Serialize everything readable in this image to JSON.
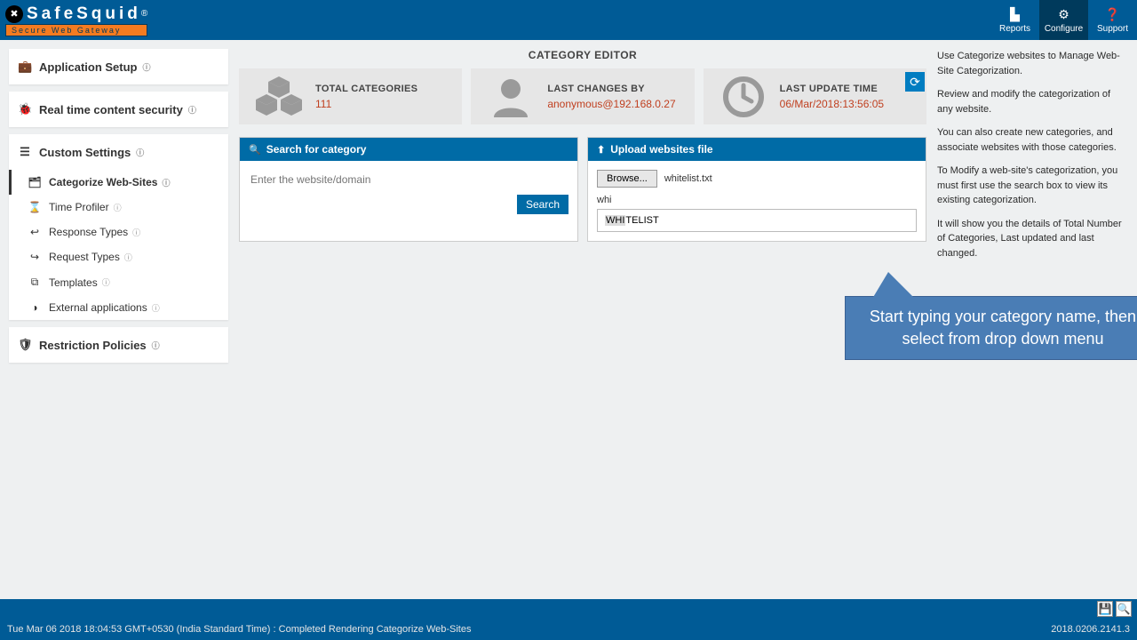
{
  "brand": {
    "name": "SafeSquid",
    "reg": "®",
    "tagline": "Secure Web Gateway"
  },
  "nav": {
    "reports": "Reports",
    "configure": "Configure",
    "support": "Support"
  },
  "sidebar": {
    "groups": [
      {
        "label": "Application Setup"
      },
      {
        "label": "Real time content security"
      },
      {
        "label": "Custom Settings",
        "items": [
          {
            "icon": "🗂",
            "label": "Categorize Web-Sites",
            "active": true
          },
          {
            "icon": "⌛",
            "label": "Time Profiler"
          },
          {
            "icon": "↩",
            "label": "Response Types"
          },
          {
            "icon": "↪",
            "label": "Request Types"
          },
          {
            "icon": "⧉",
            "label": "Templates"
          },
          {
            "icon": "◑",
            "label": "External applications"
          }
        ]
      },
      {
        "label": "Restriction Policies"
      }
    ]
  },
  "page": {
    "title": "CATEGORY EDITOR",
    "stats": {
      "total_label": "TOTAL CATEGORIES",
      "total_value": "111",
      "changes_label": "LAST CHANGES BY",
      "changes_value": "anonymous@192.168.0.27",
      "update_label": "LAST UPDATE TIME",
      "update_value": "06/Mar/2018:13:56:05"
    },
    "search": {
      "title": "Search for category",
      "placeholder": "Enter the website/domain",
      "button": "Search"
    },
    "upload": {
      "title": "Upload websites file",
      "browse": "Browse...",
      "filename": "whitelist.txt",
      "typed": "whi",
      "dd_highlight": "WHI",
      "dd_rest": "TELIST"
    },
    "callout": "Start typing your category name, then select from drop down menu"
  },
  "help": {
    "p1": "Use Categorize websites to Manage Web-Site Categorization.",
    "p2": "Review and modify the categorization of any website.",
    "p3": "You can also create new categories, and associate websites with those categories.",
    "p4": "To Modify a web-site's categorization, you must first use the search box to view its existing categorization.",
    "p5": "It will show you the details of Total Number of Categories, Last updated and last changed."
  },
  "footer": {
    "status": "Tue Mar 06 2018 18:04:53 GMT+0530 (India Standard Time) : Completed Rendering Categorize Web-Sites",
    "version": "2018.0206.2141.3"
  }
}
